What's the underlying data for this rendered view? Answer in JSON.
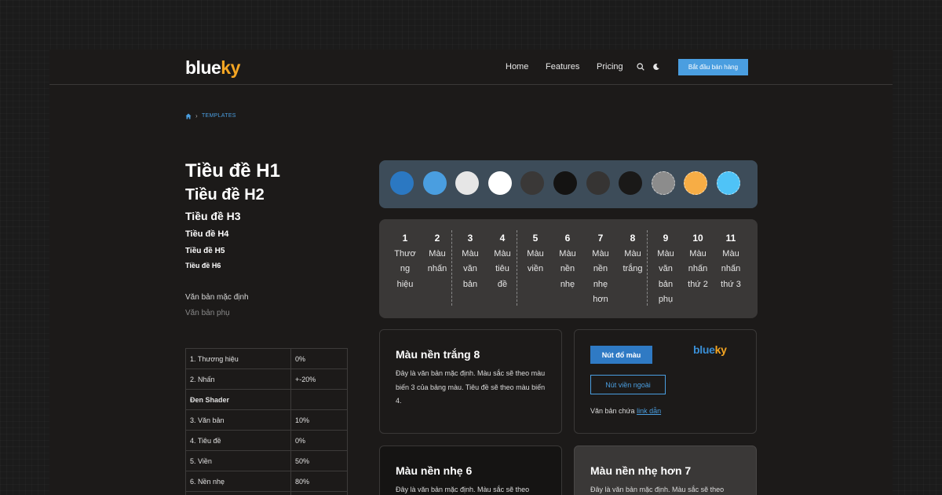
{
  "header": {
    "logo_text": "blue",
    "logo_accent": "ky",
    "nav": [
      "Home",
      "Features",
      "Pricing"
    ],
    "search_icon": "search-icon",
    "theme_icon": "moon-icon",
    "cta_label": "Bắt đầu bán hàng"
  },
  "breadcrumb": {
    "home_icon": "home-icon",
    "current": "TEMPLATES"
  },
  "typography": {
    "h1": "Tiều đề H1",
    "h2": "Tiều đề H2",
    "h3": "Tiều đề H3",
    "h4": "Tiều đề H4",
    "h5": "Tiều đề H5",
    "h6": "Tiều đề H6",
    "default_text": "Văn bản mặc định",
    "sub_text": "Văn bản phụ"
  },
  "shader_table": [
    {
      "label": "1. Thương hiệu",
      "value": "0%",
      "bold": false
    },
    {
      "label": "2. Nhấn",
      "value": "+-20%",
      "bold": false
    },
    {
      "label": "Đen Shader",
      "value": "",
      "bold": true
    },
    {
      "label": "3. Văn bản",
      "value": "10%",
      "bold": false
    },
    {
      "label": "4. Tiêu đề",
      "value": "0%",
      "bold": false
    },
    {
      "label": "5. Viền",
      "value": "50%",
      "bold": false
    },
    {
      "label": "6. Nền nhẹ",
      "value": "80%",
      "bold": false
    },
    {
      "label": "",
      "value": "",
      "bold": false
    }
  ],
  "swatches": [
    {
      "color": "#2b78c2",
      "dashed": false
    },
    {
      "color": "#4a9ee0",
      "dashed": false
    },
    {
      "color": "#e6e6e6",
      "dashed": false
    },
    {
      "color": "#ffffff",
      "dashed": false
    },
    {
      "color": "#3a3837",
      "dashed": false
    },
    {
      "color": "#141312",
      "dashed": false
    },
    {
      "color": "#363433",
      "dashed": false
    },
    {
      "color": "#1a1918",
      "dashed": false
    },
    {
      "color": "#8c8c8c",
      "dashed": true
    },
    {
      "color": "#f7ad45",
      "dashed": true
    },
    {
      "color": "#4fc3f7",
      "dashed": true
    }
  ],
  "legend": [
    {
      "num": "1",
      "lines": [
        "Thươ",
        "ng",
        "hiệu"
      ]
    },
    {
      "num": "2",
      "lines": [
        "Màu",
        "nhấn"
      ]
    },
    {
      "num": "3",
      "lines": [
        "Màu",
        "văn",
        "bản"
      ]
    },
    {
      "num": "4",
      "lines": [
        "Màu",
        "tiêu",
        "đề"
      ]
    },
    {
      "num": "5",
      "lines": [
        "Màu",
        "viền"
      ]
    },
    {
      "num": "6",
      "lines": [
        "Màu",
        "nền",
        "nhẹ"
      ]
    },
    {
      "num": "7",
      "lines": [
        "Màu",
        "nền",
        "nhẹ",
        "hơn"
      ]
    },
    {
      "num": "8",
      "lines": [
        "Màu",
        "trắng"
      ]
    },
    {
      "num": "9",
      "lines": [
        "Màu",
        "văn",
        "bản",
        "phụ"
      ]
    },
    {
      "num": "10",
      "lines": [
        "Màu",
        "nhấn",
        "thứ 2"
      ]
    },
    {
      "num": "11",
      "lines": [
        "Màu",
        "nhấn",
        "thứ 3"
      ]
    }
  ],
  "cards": {
    "white": {
      "title": "Màu nền trắng 8",
      "body": "Đây là văn bản mặc định. Màu sắc sẽ theo màu biến 3 của bảng màu. Tiêu đề sẽ theo màu biến 4."
    },
    "buttons": {
      "gradient_label": "Nút đổ màu",
      "outline_label": "Nút viền ngoài",
      "logo_text": "blue",
      "logo_accent": "ky",
      "link_prefix": "Văn bản chứa ",
      "link_label": "link dẫn"
    },
    "light": {
      "title": "Màu nền nhẹ 6",
      "body": "Đây là văn bản mặc định. Màu sắc sẽ theo"
    },
    "lighter": {
      "title": "Màu nền nhẹ hơn 7",
      "body": "Đây là văn bản mặc định. Màu sắc sẽ theo"
    }
  }
}
